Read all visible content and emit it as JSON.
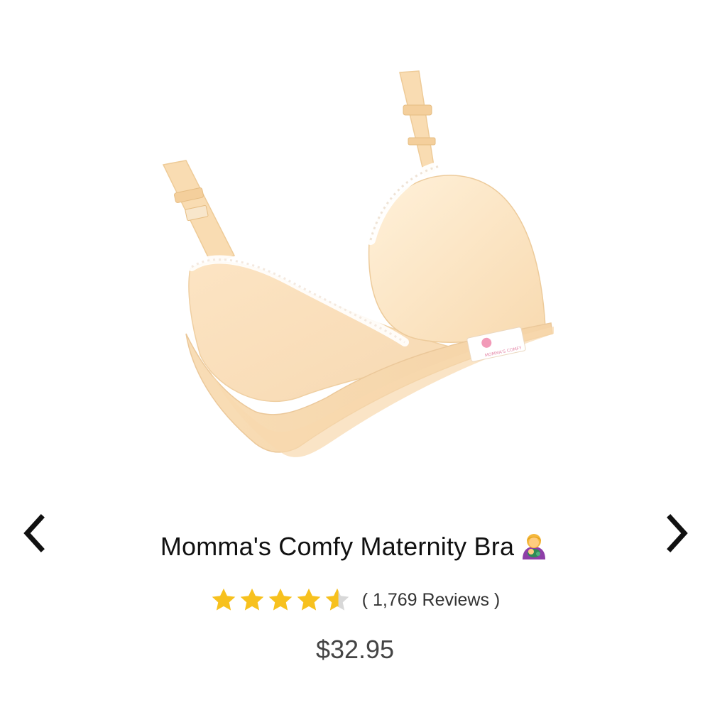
{
  "product": {
    "title": "Momma's Comfy Maternity Bra",
    "emoji_icon": "woman-feeding-baby-icon",
    "rating": 4.5,
    "max_rating": 5,
    "reviews_text": "( 1,769 Reviews )",
    "price": "$32.95",
    "image_alt": "Beige maternity bra with white lace trim",
    "label_text": "MOMMA'S COMFY"
  },
  "carousel": {
    "prev_icon": "chevron-left-icon",
    "next_icon": "chevron-right-icon"
  },
  "colors": {
    "star": "#F7C11E",
    "star_empty": "#D8D8D8",
    "fabric": "#FCE3BE",
    "title": "#111111",
    "price": "#444444"
  }
}
